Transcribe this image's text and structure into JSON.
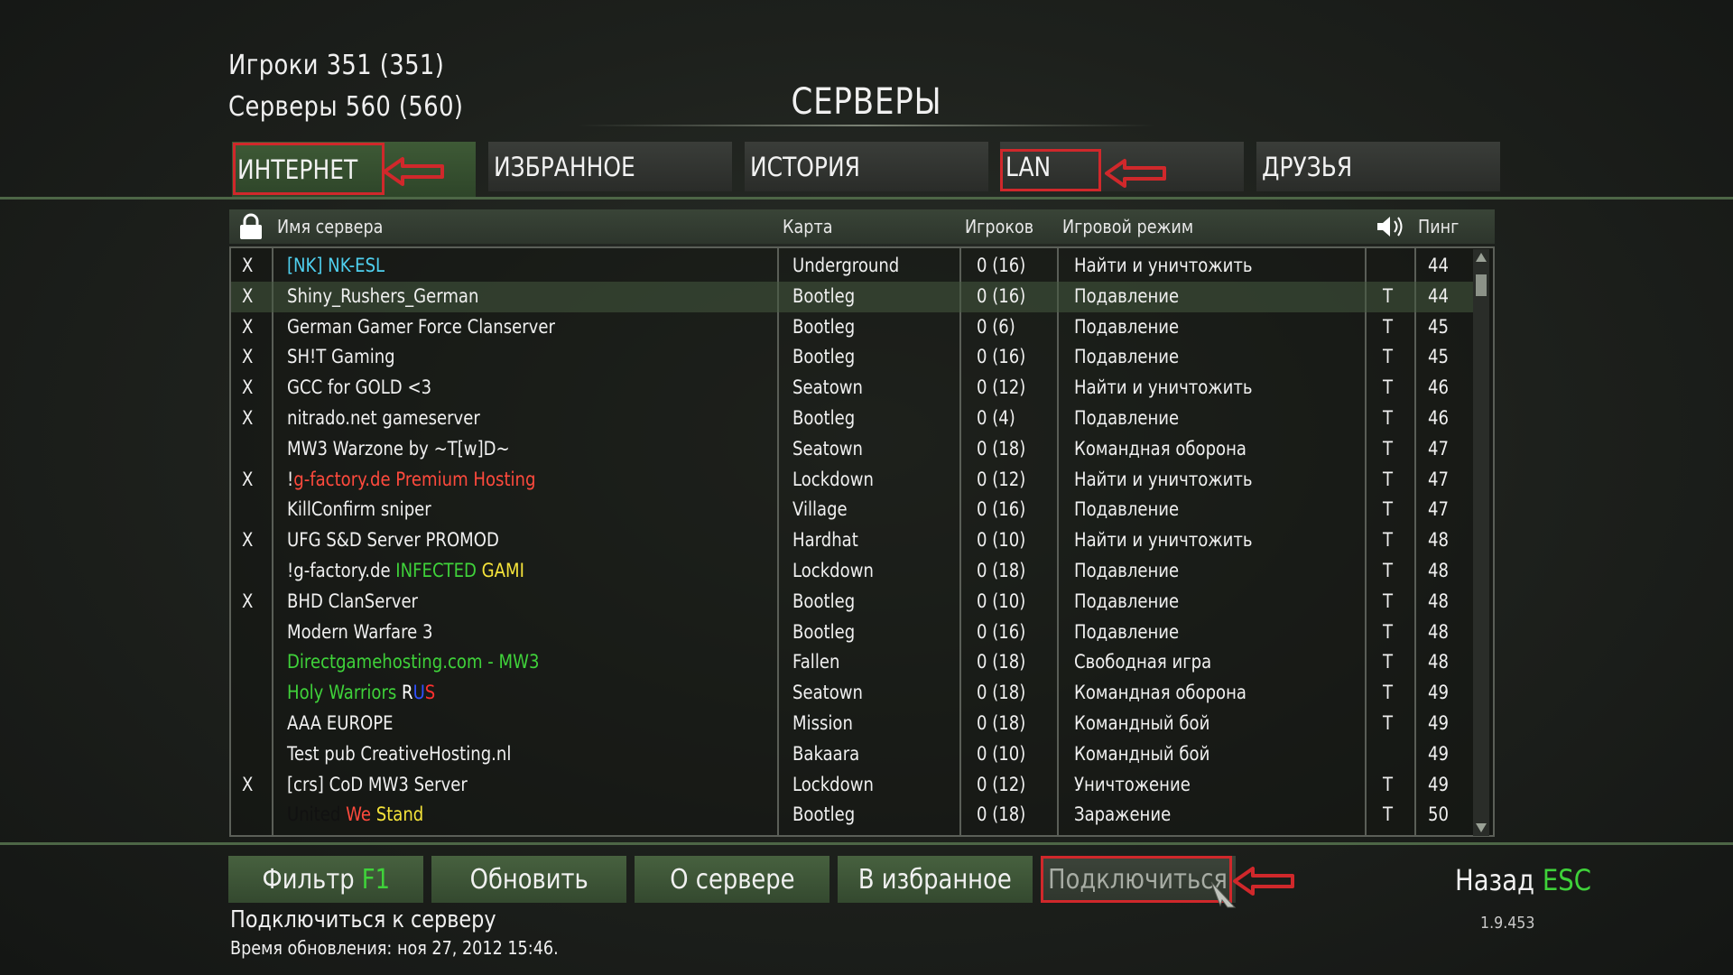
{
  "header": {
    "players": "Игроки 351 (351)",
    "servers": "Серверы 560 (560)",
    "title": "СЕРВЕРЫ"
  },
  "tabs": [
    {
      "label": "ИНТЕРНЕТ",
      "active": true
    },
    {
      "label": "ИЗБРАННОЕ"
    },
    {
      "label": "ИСТОРИЯ"
    },
    {
      "label": "LAN"
    },
    {
      "label": "ДРУЗЬЯ"
    }
  ],
  "columns": {
    "lock_icon": "lock-icon",
    "name": "Имя сервера",
    "map": "Карта",
    "players": "Игроков",
    "mode": "Игровой режим",
    "sound_icon": "speaker-icon",
    "ping": "Пинг"
  },
  "rows": [
    {
      "lock": "X",
      "name": [
        {
          "t": "[NK] NK-ESL",
          "c": "#4fd0ef"
        }
      ],
      "map": "Underground",
      "players": "0 (16)",
      "mode": "Найти и уничтожить",
      "snd": "",
      "ping": "44"
    },
    {
      "lock": "X",
      "name": [
        {
          "t": "Shiny_Rushers_German"
        }
      ],
      "map": "Bootleg",
      "players": "0 (16)",
      "mode": "Подавление",
      "snd": "T",
      "ping": "44",
      "selected": true
    },
    {
      "lock": "X",
      "name": [
        {
          "t": "German Gamer Force Clanserver"
        }
      ],
      "map": "Bootleg",
      "players": "0 (6)",
      "mode": "Подавление",
      "snd": "T",
      "ping": "45"
    },
    {
      "lock": "X",
      "name": [
        {
          "t": "SH!T Gaming"
        }
      ],
      "map": "Bootleg",
      "players": "0 (16)",
      "mode": "Подавление",
      "snd": "T",
      "ping": "45"
    },
    {
      "lock": "X",
      "name": [
        {
          "t": "GCC for GOLD <3"
        }
      ],
      "map": "Seatown",
      "players": "0 (12)",
      "mode": "Найти и уничтожить",
      "snd": "T",
      "ping": "46"
    },
    {
      "lock": "X",
      "name": [
        {
          "t": "nitrado.net gameserver"
        }
      ],
      "map": "Bootleg",
      "players": "0 (4)",
      "mode": "Подавление",
      "snd": "T",
      "ping": "46"
    },
    {
      "lock": "",
      "name": [
        {
          "t": "MW3 Warzone by ~T[w]D~"
        }
      ],
      "map": "Seatown",
      "players": "0 (18)",
      "mode": "Командная оборона",
      "snd": "T",
      "ping": "47"
    },
    {
      "lock": "X",
      "name": [
        {
          "t": "!"
        },
        {
          "t": "g-factory.de Premium Hosting",
          "c": "#ff4a3d"
        }
      ],
      "map": "Lockdown",
      "players": "0 (12)",
      "mode": "Найти и уничтожить",
      "snd": "T",
      "ping": "47"
    },
    {
      "lock": "",
      "name": [
        {
          "t": "KillConfirm sniper"
        }
      ],
      "map": "Village",
      "players": "0 (16)",
      "mode": "Подавление",
      "snd": "T",
      "ping": "47"
    },
    {
      "lock": "X",
      "name": [
        {
          "t": "UFG S&D Server PROMOD"
        }
      ],
      "map": "Hardhat",
      "players": "0 (10)",
      "mode": "Найти и уничтожить",
      "snd": "T",
      "ping": "48"
    },
    {
      "lock": "",
      "name": [
        {
          "t": "!g-factory.de "
        },
        {
          "t": "INFECTED ",
          "c": "#3fd23a"
        },
        {
          "t": "GAMI",
          "c": "#f5e33a"
        }
      ],
      "map": "Lockdown",
      "players": "0 (18)",
      "mode": "Подавление",
      "snd": "T",
      "ping": "48"
    },
    {
      "lock": "X",
      "name": [
        {
          "t": "BHD ClanServer"
        }
      ],
      "map": "Bootleg",
      "players": "0 (10)",
      "mode": "Подавление",
      "snd": "T",
      "ping": "48"
    },
    {
      "lock": "",
      "name": [
        {
          "t": "Modern Warfare 3"
        }
      ],
      "map": "Bootleg",
      "players": "0 (16)",
      "mode": "Подавление",
      "snd": "T",
      "ping": "48"
    },
    {
      "lock": "",
      "name": [
        {
          "t": "Directgamehosting.com - MW3",
          "c": "#3fd23a"
        }
      ],
      "map": "Fallen",
      "players": "0 (18)",
      "mode": "Свободная игра",
      "snd": "T",
      "ping": "48"
    },
    {
      "lock": "",
      "name": [
        {
          "t": "Holy Warriors ",
          "c": "#3fd23a"
        },
        {
          "t": "R",
          "c": "#ffffff"
        },
        {
          "t": "U",
          "c": "#3050ff"
        },
        {
          "t": "S",
          "c": "#ff3030"
        }
      ],
      "map": "Seatown",
      "players": "0 (18)",
      "mode": "Командная оборона",
      "snd": "T",
      "ping": "49"
    },
    {
      "lock": "",
      "name": [
        {
          "t": "AAA EUROPE"
        }
      ],
      "map": "Mission",
      "players": "0 (18)",
      "mode": "Командный бой",
      "snd": "T",
      "ping": "49"
    },
    {
      "lock": "",
      "name": [
        {
          "t": "Test pub CreativeHosting.nl"
        }
      ],
      "map": "Bakaara",
      "players": "0 (10)",
      "mode": "Командный бой",
      "snd": "",
      "ping": "49"
    },
    {
      "lock": "X",
      "name": [
        {
          "t": "[crs] CoD MW3 Server"
        }
      ],
      "map": "Lockdown",
      "players": "0 (12)",
      "mode": "Уничтожение",
      "snd": "T",
      "ping": "49"
    },
    {
      "lock": "",
      "name": [
        {
          "t": "United ",
          "c": "#111111"
        },
        {
          "t": "We ",
          "c": "#ff4a3d"
        },
        {
          "t": "Stand",
          "c": "#f5e33a"
        }
      ],
      "map": "Bootleg",
      "players": "0 (18)",
      "mode": "Заражение",
      "snd": "T",
      "ping": "50"
    }
  ],
  "buttons": {
    "filter": {
      "label": "Фильтр ",
      "key": "F1"
    },
    "refresh": "Обновить",
    "about": "О сервере",
    "favorite": "В избранное",
    "connect": "Подключиться"
  },
  "back": {
    "label": "Назад ",
    "key": "ESC"
  },
  "version": "1.9.453",
  "status": "Подключиться к серверу",
  "update_time": "Время обновления: ноя 27, 2012    15:46.",
  "colors": {
    "accent_green": "#3fd23a",
    "callout_red": "#d0282b",
    "tab_active": "#3e5a36"
  }
}
